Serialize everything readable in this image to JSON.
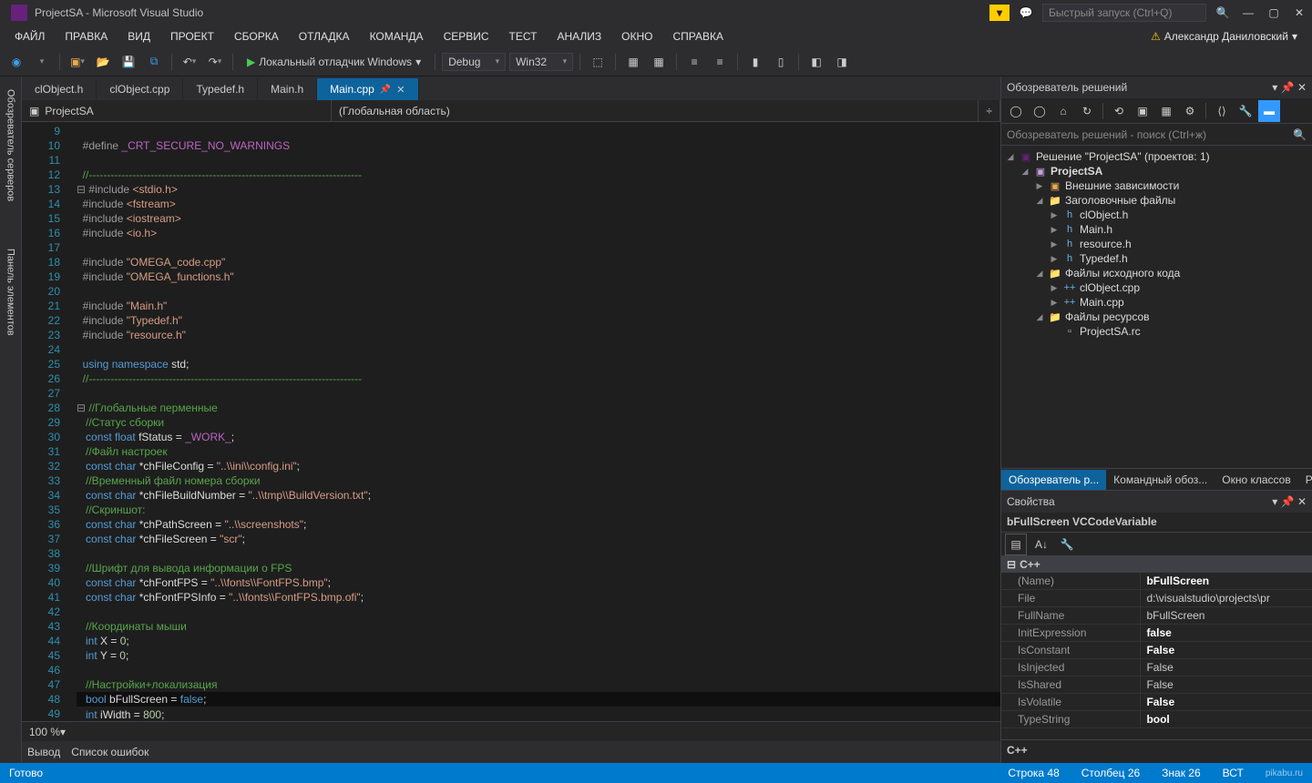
{
  "title": "ProjectSA - Microsoft Visual Studio",
  "quicklaunch_placeholder": "Быстрый запуск (Ctrl+Q)",
  "user": "Александр Даниловский",
  "menu": [
    "ФАЙЛ",
    "ПРАВКА",
    "ВИД",
    "ПРОЕКТ",
    "СБОРКА",
    "ОТЛАДКА",
    "КОМАНДА",
    "СЕРВИС",
    "ТЕСТ",
    "АНАЛИЗ",
    "ОКНО",
    "СПРАВКА"
  ],
  "debugger": "Локальный отладчик Windows",
  "config": "Debug",
  "platform": "Win32",
  "left_tabs": [
    "Обозреватель серверов",
    "Панель элементов"
  ],
  "file_tabs": [
    {
      "label": "clObject.h",
      "active": false
    },
    {
      "label": "clObject.cpp",
      "active": false
    },
    {
      "label": "Typedef.h",
      "active": false
    },
    {
      "label": "Main.h",
      "active": false
    },
    {
      "label": "Main.cpp",
      "active": true,
      "pinned": true
    }
  ],
  "ctx_left": "ProjectSA",
  "ctx_right": "(Глобальная область)",
  "zoom": "100 %",
  "bottom": [
    "Вывод",
    "Список ошибок"
  ],
  "se": {
    "title": "Обозреватель решений",
    "search": "Обозреватель решений - поиск (Ctrl+ж)",
    "solution": "Решение \"ProjectSA\" (проектов: 1)",
    "project": "ProjectSA",
    "ext": "Внешние зависимости",
    "hdr": "Заголовочные файлы",
    "hdrs": [
      "clObject.h",
      "Main.h",
      "resource.h",
      "Typedef.h"
    ],
    "src": "Файлы исходного кода",
    "srcs": [
      "clObject.cpp",
      "Main.cpp"
    ],
    "res": "Файлы ресурсов",
    "ress": [
      "ProjectSA.rc"
    ],
    "tabs": [
      "Обозреватель р...",
      "Командный обоз...",
      "Окно классов",
      "Ресурсы"
    ]
  },
  "props": {
    "title": "Свойства",
    "sub": "bFullScreen  VCCodeVariable",
    "cat": "C++",
    "rows": [
      {
        "k": "(Name)",
        "v": "bFullScreen",
        "bold": true
      },
      {
        "k": "File",
        "v": "d:\\visualstudio\\projects\\pr"
      },
      {
        "k": "FullName",
        "v": "bFullScreen"
      },
      {
        "k": "InitExpression",
        "v": "false",
        "bold": true
      },
      {
        "k": "IsConstant",
        "v": "False",
        "bold": true
      },
      {
        "k": "IsInjected",
        "v": "False"
      },
      {
        "k": "IsShared",
        "v": "False"
      },
      {
        "k": "IsVolatile",
        "v": "False",
        "bold": true
      },
      {
        "k": "TypeString",
        "v": "bool",
        "bold": true
      }
    ],
    "desc": "C++"
  },
  "status": {
    "ready": "Готово",
    "line": "Строка 48",
    "col": "Столбец 26",
    "ch": "Знак 26",
    "ins": "ВСТ"
  },
  "code": {
    "start": 9,
    "lines": [
      {
        "n": 9,
        "h": ""
      },
      {
        "n": 10,
        "h": "<span class='c-pp'>#define</span> <span class='c-mac'>_CRT_SECURE_NO_WARNINGS</span>"
      },
      {
        "n": 11,
        "h": ""
      },
      {
        "n": 12,
        "h": "<span class='c-cmt'>//---------------------------------------------------------------------------</span>"
      },
      {
        "n": 13,
        "h": "<span class='c-pp'>#include</span> <span class='c-str'>&lt;stdio.h&gt;</span>",
        "fold": "-"
      },
      {
        "n": 14,
        "h": "<span class='c-pp'>#include</span> <span class='c-str'>&lt;fstream&gt;</span>"
      },
      {
        "n": 15,
        "h": "<span class='c-pp'>#include</span> <span class='c-str'>&lt;iostream&gt;</span>"
      },
      {
        "n": 16,
        "h": "<span class='c-pp'>#include</span> <span class='c-str'>&lt;io.h&gt;</span>"
      },
      {
        "n": 17,
        "h": ""
      },
      {
        "n": 18,
        "h": "<span class='c-pp'>#include</span> <span class='c-str'>\"OMEGA_code.cpp\"</span>"
      },
      {
        "n": 19,
        "h": "<span class='c-pp'>#include</span> <span class='c-str'>\"OMEGA_functions.h\"</span>"
      },
      {
        "n": 20,
        "h": ""
      },
      {
        "n": 21,
        "h": "<span class='c-pp'>#include</span> <span class='c-str'>\"Main.h\"</span>"
      },
      {
        "n": 22,
        "h": "<span class='c-pp'>#include</span> <span class='c-str'>\"Typedef.h\"</span>"
      },
      {
        "n": 23,
        "h": "<span class='c-pp'>#include</span> <span class='c-str'>\"resource.h\"</span>"
      },
      {
        "n": 24,
        "h": ""
      },
      {
        "n": 25,
        "h": "<span class='c-key'>using</span> <span class='c-key'>namespace</span> std;"
      },
      {
        "n": 26,
        "h": "<span class='c-cmt'>//---------------------------------------------------------------------------</span>"
      },
      {
        "n": 27,
        "h": ""
      },
      {
        "n": 28,
        "h": "<span class='c-cmt'>//Глобальные перменные</span>",
        "fold": "-"
      },
      {
        "n": 29,
        "h": " <span class='c-cmt'>//Статус сборки</span>"
      },
      {
        "n": 30,
        "h": " <span class='c-key'>const</span> <span class='c-key'>float</span> fStatus = <span class='c-mac'>_WORK_</span>;"
      },
      {
        "n": 31,
        "h": " <span class='c-cmt'>//Файл настроек</span>"
      },
      {
        "n": 32,
        "h": " <span class='c-key'>const</span> <span class='c-key'>char</span> *chFileConfig = <span class='c-str'>\"..\\\\ini\\\\config.ini\"</span>;"
      },
      {
        "n": 33,
        "h": " <span class='c-cmt'>//Временный файл номера сборки</span>"
      },
      {
        "n": 34,
        "h": " <span class='c-key'>const</span> <span class='c-key'>char</span> *chFileBuildNumber = <span class='c-str'>\"..\\\\tmp\\\\BuildVersion.txt\"</span>;"
      },
      {
        "n": 35,
        "h": " <span class='c-cmt'>//Скриншот:</span>"
      },
      {
        "n": 36,
        "h": " <span class='c-key'>const</span> <span class='c-key'>char</span> *chPathScreen = <span class='c-str'>\"..\\\\screenshots\"</span>;"
      },
      {
        "n": 37,
        "h": " <span class='c-key'>const</span> <span class='c-key'>char</span> *chFileScreen = <span class='c-str'>\"scr\"</span>;"
      },
      {
        "n": 38,
        "h": ""
      },
      {
        "n": 39,
        "h": " <span class='c-cmt'>//Шрифт для вывода информации о FPS</span>"
      },
      {
        "n": 40,
        "h": " <span class='c-key'>const</span> <span class='c-key'>char</span> *chFontFPS = <span class='c-str'>\"..\\\\fonts\\\\FontFPS.bmp\"</span>;"
      },
      {
        "n": 41,
        "h": " <span class='c-key'>const</span> <span class='c-key'>char</span> *chFontFPSInfo = <span class='c-str'>\"..\\\\fonts\\\\FontFPS.bmp.ofi\"</span>;"
      },
      {
        "n": 42,
        "h": ""
      },
      {
        "n": 43,
        "h": " <span class='c-cmt'>//Координаты мыши</span>"
      },
      {
        "n": 44,
        "h": " <span class='c-key'>int</span> X = <span class='c-num'>0</span>;"
      },
      {
        "n": 45,
        "h": " <span class='c-key'>int</span> Y = <span class='c-num'>0</span>;"
      },
      {
        "n": 46,
        "h": ""
      },
      {
        "n": 47,
        "h": " <span class='c-cmt'>//Настройки+локализация</span>"
      },
      {
        "n": 48,
        "h": " <span class='c-key'>bool</span> bFullScreen = <span class='c-key'>false</span>;",
        "hl": true
      },
      {
        "n": 49,
        "h": " <span class='c-key'>int</span> iWidth = <span class='c-num'>800</span>;"
      }
    ]
  },
  "watermark": "pikabu.ru"
}
